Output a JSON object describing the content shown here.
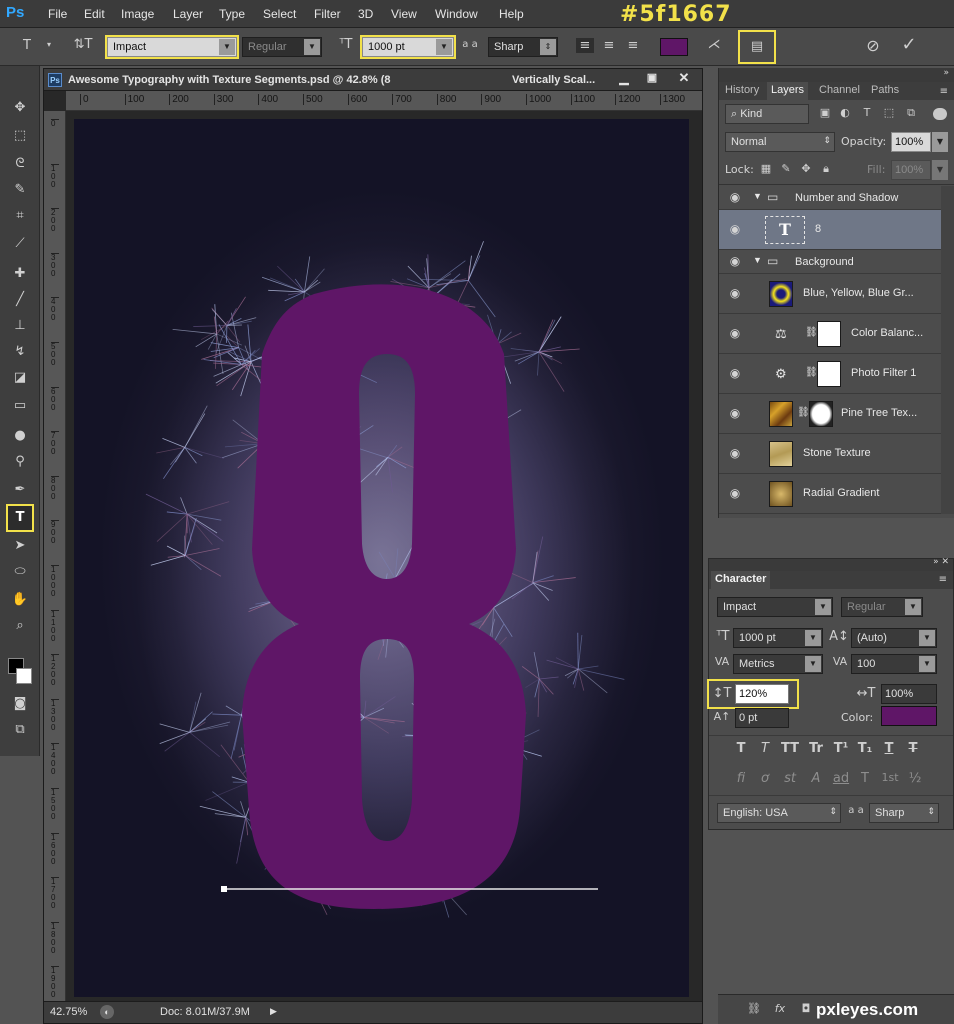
{
  "app": {
    "logo": "Ps",
    "hex_note": "#5f1667"
  },
  "menu": [
    "File",
    "Edit",
    "Image",
    "Layer",
    "Type",
    "Select",
    "Filter",
    "3D",
    "View",
    "Window",
    "Help"
  ],
  "options": {
    "font_family": "Impact",
    "font_style": "Regular",
    "font_size": "1000 pt",
    "aa_label": "a a",
    "antialias": "Sharp",
    "text_color": "#5f1667"
  },
  "document": {
    "title": "Awesome Typography with Texture Segments.psd @ 42.8% (8",
    "title_right": "Vertically Scal...",
    "ruler_h": [
      "0",
      "100",
      "200",
      "300",
      "400",
      "500",
      "600",
      "700",
      "800",
      "900",
      "1000",
      "1100",
      "1200",
      "1300"
    ],
    "ruler_v": [
      "0",
      "1 0 0",
      "2 0 0",
      "3 0 0",
      "4 0 0",
      "5 0 0",
      "6 0 0",
      "7 0 0",
      "8 0 0",
      "9 0 0",
      "1 0 0 0",
      "1 1 0 0",
      "1 2 0 0",
      "1 3 0 0",
      "1 4 0 0",
      "1 5 0 0",
      "1 6 0 0",
      "1 7 0 0",
      "1 8 0 0",
      "1 9 0 0"
    ],
    "glyph": "8",
    "glyph_color": "#5f1667",
    "zoom": "42.75%",
    "doc_info": "Doc: 8.01M/37.9M"
  },
  "layers_panel": {
    "tabs": [
      "History",
      "Layers",
      "Channel",
      "Paths"
    ],
    "kind_label": "Kind",
    "blend_mode": "Normal",
    "opacity_label": "Opacity:",
    "opacity": "100%",
    "lock_label": "Lock:",
    "fill_label": "Fill:",
    "fill": "100%",
    "layers": [
      {
        "name": "Number and Shadow",
        "type": "group"
      },
      {
        "name": "8",
        "type": "text"
      },
      {
        "name": "Background",
        "type": "group"
      },
      {
        "name": "Blue, Yellow, Blue Gr...",
        "type": "gradient"
      },
      {
        "name": "Color Balanc...",
        "type": "adjustment"
      },
      {
        "name": "Photo Filter 1",
        "type": "adjustment"
      },
      {
        "name": "Pine Tree Tex...",
        "type": "image"
      },
      {
        "name": "Stone Texture",
        "type": "image"
      },
      {
        "name": "Radial Gradient",
        "type": "image"
      }
    ]
  },
  "character_panel": {
    "title": "Character",
    "font_family": "Impact",
    "font_style": "Regular",
    "font_size": "1000 pt",
    "leading": "(Auto)",
    "kerning": "Metrics",
    "tracking": "100",
    "vertical_scale": "120%",
    "horizontal_scale": "100%",
    "baseline_shift": "0 pt",
    "color_label": "Color:",
    "color": "#5f1667",
    "style_buttons": [
      "T",
      "T",
      "TT",
      "Tr",
      "T¹",
      "T₁",
      "T",
      "T"
    ],
    "opentype_buttons": [
      "fi",
      "ơ",
      "st",
      "A",
      "ad",
      "T",
      "1st",
      "½"
    ],
    "language": "English: USA",
    "aa_label": "a a",
    "antialias": "Sharp"
  },
  "watermark": "pxleyes.com"
}
